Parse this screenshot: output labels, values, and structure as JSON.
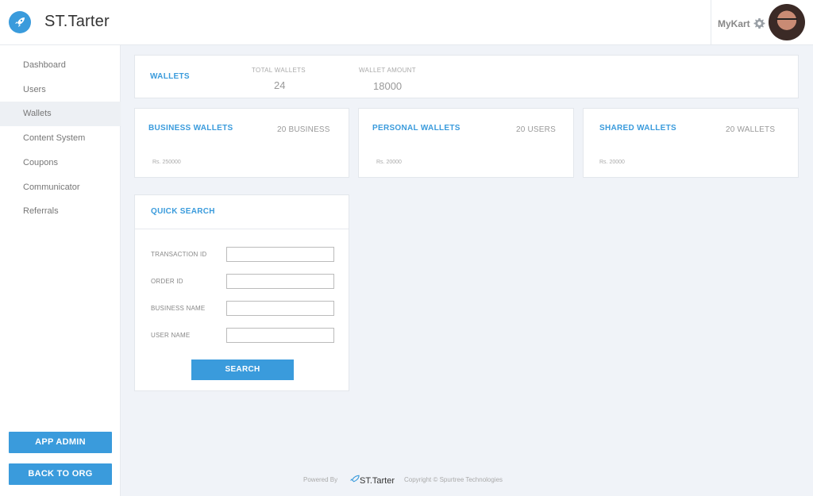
{
  "header": {
    "brand": "ST.Tarter",
    "org_name": "MyKart",
    "logo_icon": "rocket-icon",
    "settings_icon": "gear-icon"
  },
  "sidebar": {
    "items": [
      {
        "label": "Dashboard"
      },
      {
        "label": "Users"
      },
      {
        "label": "Wallets",
        "active": true
      },
      {
        "label": "Content System"
      },
      {
        "label": "Coupons"
      },
      {
        "label": "Communicator"
      },
      {
        "label": "Referrals"
      }
    ],
    "app_admin_label": "APP ADMIN",
    "back_to_org_label": "BACK TO ORG"
  },
  "summary": {
    "title": "WALLETS",
    "total_wallets_label": "TOTAL WALLETS",
    "total_wallets_value": "24",
    "wallet_amount_label": "WALLET AMOUNT",
    "wallet_amount_value": "18000"
  },
  "wallet_cards": [
    {
      "title": "BUSINESS WALLETS",
      "count": "20 BUSINESS",
      "amount": "Rs. 250000"
    },
    {
      "title": "PERSONAL WALLETS",
      "count": "20 USERS",
      "amount": "Rs. 20000"
    },
    {
      "title": "SHARED WALLETS",
      "count": "20 WALLETS",
      "amount": "Rs. 20000"
    }
  ],
  "quick_search": {
    "title": "QUICK SEARCH",
    "fields": [
      {
        "label": "TRANSACTION ID",
        "value": ""
      },
      {
        "label": "ORDER ID",
        "value": ""
      },
      {
        "label": "BUSINESS NAME",
        "value": ""
      },
      {
        "label": "USER NAME",
        "value": ""
      }
    ],
    "button_label": "SEARCH"
  },
  "footer": {
    "powered_by": "Powered By",
    "brand": "ST.Tarter",
    "copyright": "Copyright © Spurtree Technologies"
  },
  "colors": {
    "accent": "#3a9bdc",
    "background": "#f0f3f8"
  }
}
